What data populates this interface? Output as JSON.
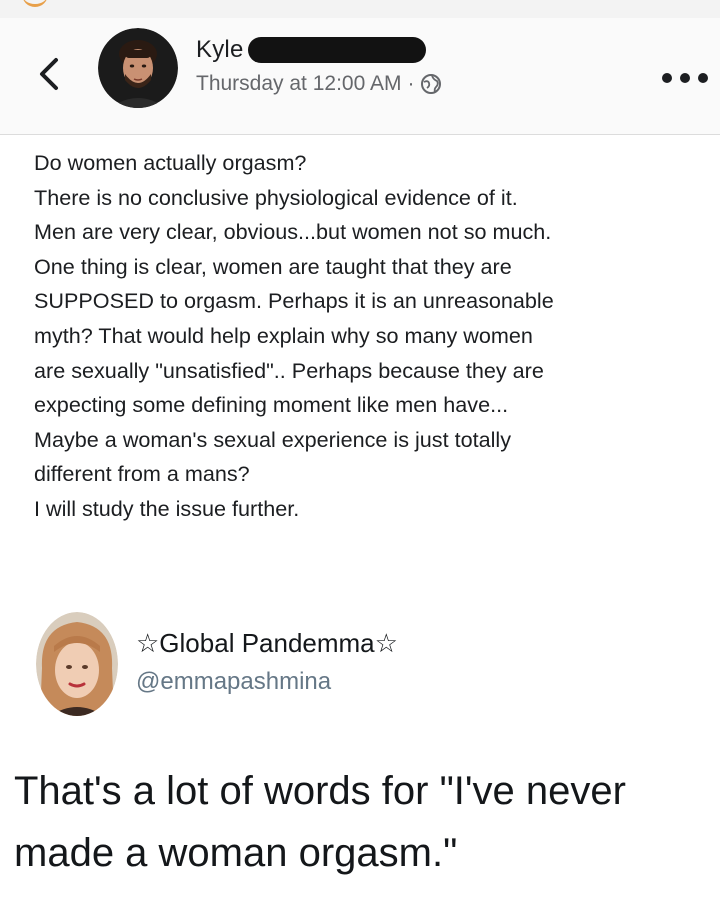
{
  "fb_post": {
    "author_name": "Kyle",
    "timestamp": "Thursday at 12:00 AM",
    "separator": "·",
    "privacy_icon": "globe-icon",
    "body_lines": [
      "Do women actually orgasm?",
      "There is no conclusive physiological evidence of it.",
      "Men are very clear, obvious...but women not so much.",
      "One thing is clear, women are taught that they are",
      "SUPPOSED to orgasm.  Perhaps it is an unreasonable",
      "myth?  That would help explain why so many women",
      "are sexually \"unsatisfied\".. Perhaps because they are",
      "expecting some defining moment like men have...",
      "Maybe a woman's sexual experience is just totally",
      "different from a mans?",
      "I will study the issue further."
    ]
  },
  "tweet": {
    "display_name": "☆Global Pandemma☆",
    "handle": "@emmapashmina",
    "text_lines": [
      "That's a lot of words for \"I've never",
      "made a woman orgasm.\""
    ]
  },
  "colors": {
    "text_primary": "#1c1e21",
    "text_secondary": "#65676b",
    "tweet_handle": "#657786",
    "header_bg": "#fafafa",
    "redaction": "#121212"
  }
}
